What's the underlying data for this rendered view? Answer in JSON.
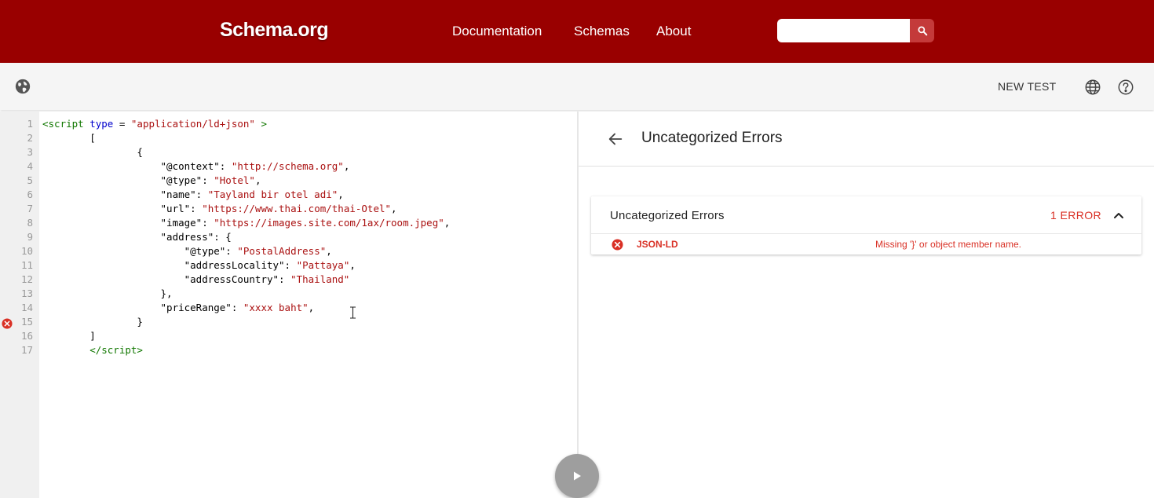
{
  "header": {
    "logo": "Schema.org",
    "nav": [
      "Documentation",
      "Schemas",
      "About"
    ],
    "search": {
      "value": "",
      "placeholder": ""
    }
  },
  "toolbar": {
    "new_test_label": "NEW TEST"
  },
  "editor": {
    "line_numbers": [
      "1",
      "2",
      "3",
      "4",
      "5",
      "6",
      "7",
      "8",
      "9",
      "10",
      "11",
      "12",
      "13",
      "14",
      "15",
      "16",
      "17"
    ],
    "error_line": "15"
  },
  "results": {
    "title": "Uncategorized Errors",
    "card": {
      "title": "Uncategorized Errors",
      "count": "1 ERROR",
      "errors": [
        {
          "source": "JSON-LD",
          "message": "Missing '}' or object member name."
        }
      ]
    }
  },
  "colors": {
    "brand": "#990000",
    "error": "#d93025",
    "run_button": "#9e9e9e"
  }
}
